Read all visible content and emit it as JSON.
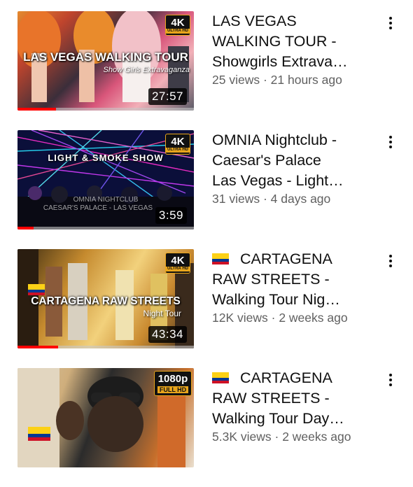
{
  "videos": [
    {
      "thumb_title": "LAS VEGAS WALKING TOUR",
      "thumb_subtitle": "Show Girls Extravaganza",
      "quality_big": "4K",
      "quality_small": "ULTRA HD",
      "duration": "27:57",
      "watch_progress": 0.22,
      "title_lines": [
        "LAS VEGAS",
        "WALKING TOUR -",
        "Showgirls Extrava…"
      ],
      "views": "25 views",
      "age": "21 hours ago",
      "has_flag": false
    },
    {
      "thumb_title": "LIGHT & SMOKE SHOW",
      "thumb_subtitle": "OMNIA NIGHTCLUB",
      "thumb_subtitle2": "CAESAR'S PALACE - LAS VEGAS",
      "quality_big": "4K",
      "quality_small": "ULTRA HD",
      "duration": "3:59",
      "watch_progress": 0.09,
      "title_lines": [
        "OMNIA Nightclub -",
        "Caesar's Palace",
        "Las Vegas - Light…"
      ],
      "views": "31 views",
      "age": "4 days ago",
      "has_flag": false
    },
    {
      "thumb_title": "CARTAGENA RAW STREETS",
      "thumb_subtitle": "Night Tour",
      "quality_big": "4K",
      "quality_small": "ULTRA HD",
      "duration": "43:34",
      "watch_progress": 0.23,
      "title_lines": [
        "CARTAGENA",
        "RAW STREETS -",
        "Walking Tour Nig…"
      ],
      "views": "12K views",
      "age": "2 weeks ago",
      "has_flag": true
    },
    {
      "quality_big": "1080p",
      "quality_small": "FULL HD",
      "title_lines": [
        "CARTAGENA",
        "RAW STREETS -",
        "Walking Tour Day…"
      ],
      "views": "5.3K views",
      "age": "2 weeks ago",
      "has_flag": true
    }
  ],
  "meta_separator": " · ",
  "icons": {
    "menu": "more-vert-icon",
    "flag": "colombia-flag-icon"
  },
  "colors": {
    "progress": "#ff0000",
    "badge_border": "#e8a51c",
    "meta_text": "#606060"
  }
}
